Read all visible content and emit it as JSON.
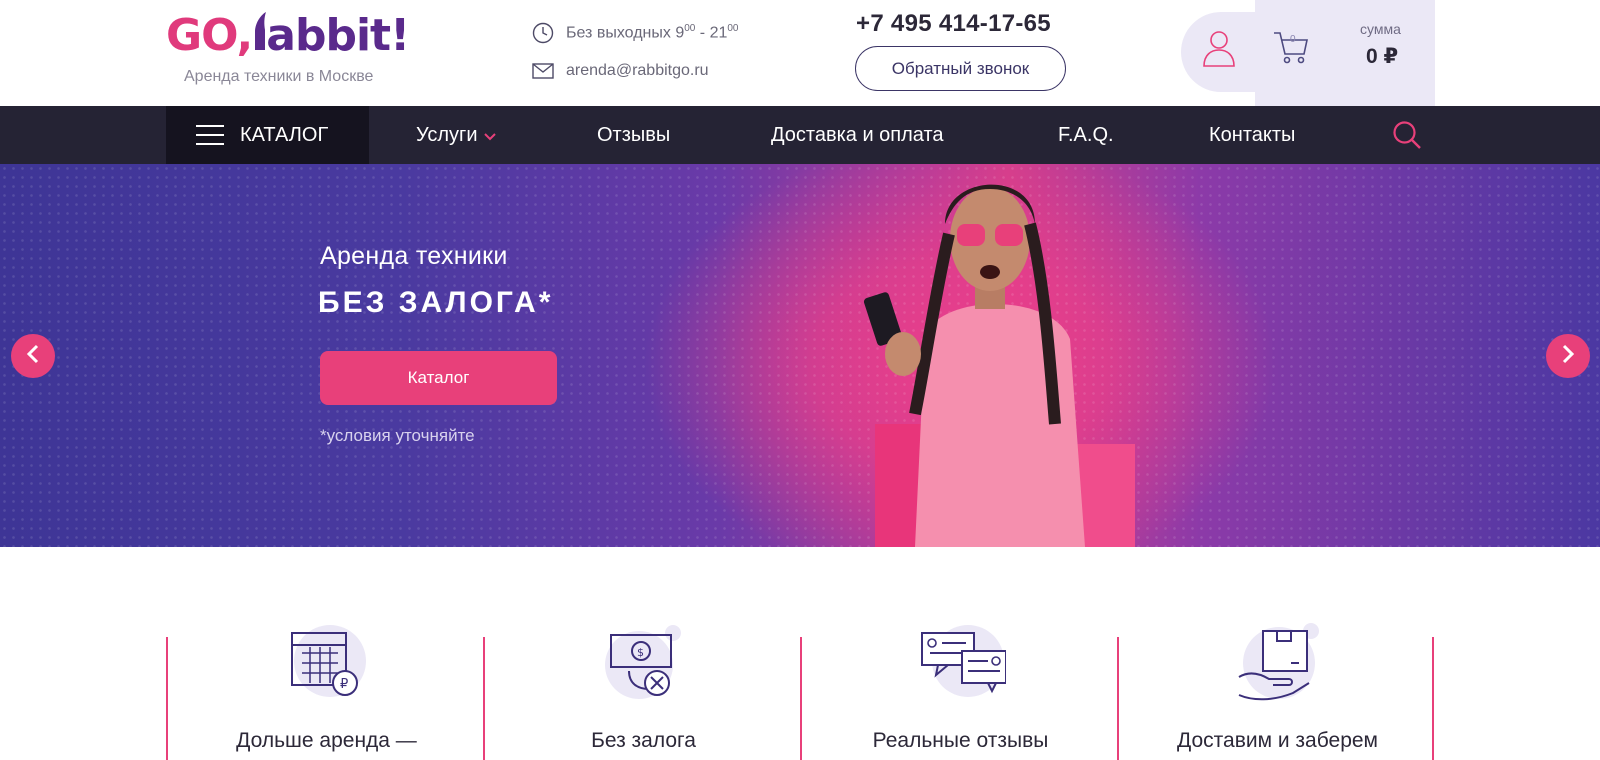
{
  "header": {
    "logo_go": "GO,",
    "logo_rabbit": "abbit!",
    "tagline": "Аренда техники в Москве",
    "hours_text": "Без выходных 9",
    "hours_sup1": "00",
    "hours_mid": " - 21",
    "hours_sup2": "00",
    "email": "arenda@rabbitgo.ru",
    "phone": "+7 495 414-17-65",
    "callback_label": "Обратный звонок",
    "cart_count": "0",
    "sum_label": "сумма",
    "sum_value": "0 ₽"
  },
  "nav": {
    "catalog_label": "КАТАЛОГ",
    "items": [
      "Услуги",
      "Отзывы",
      "Доставка и оплата",
      "F.A.Q.",
      "Контакты"
    ]
  },
  "hero": {
    "title": "Аренда техники",
    "headline": "БЕЗ ЗАЛОГА*",
    "cta_label": "Каталог",
    "note": "*условия уточняйте"
  },
  "features": [
    {
      "title": "Дольше аренда —",
      "icon": "calendar-ruble-icon"
    },
    {
      "title": "Без залога",
      "icon": "no-cash-icon"
    },
    {
      "title": "Реальные отзывы",
      "icon": "chat-reviews-icon"
    },
    {
      "title": "Доставим и заберем",
      "icon": "delivery-box-hand-icon"
    }
  ],
  "colors": {
    "accent": "#e8407a",
    "brand_purple": "#5a2a8c",
    "nav_bg": "#252334",
    "hero_blue": "#3e3596"
  }
}
